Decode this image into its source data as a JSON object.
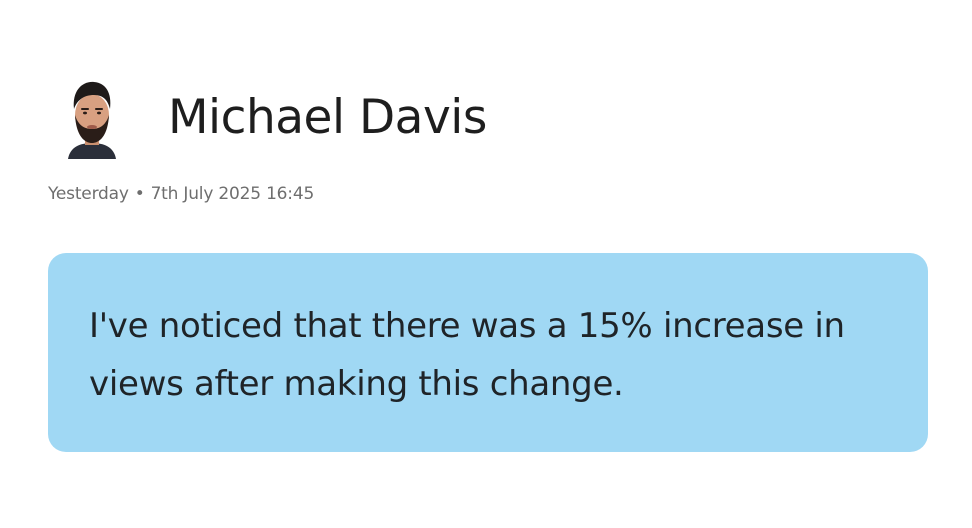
{
  "message": {
    "sender_name": "Michael Davis",
    "timestamp": {
      "relative": "Yesterday",
      "separator": "•",
      "absolute": "7th July 2025 16:45"
    },
    "body": "I've noticed that there was a 15% increase in views after making this change.",
    "bubble_color": "#a0d8f4"
  }
}
